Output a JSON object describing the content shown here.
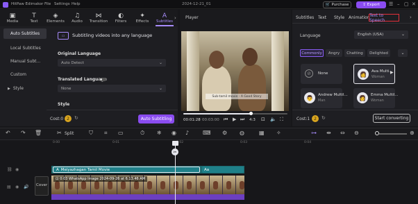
{
  "titlebar": {
    "app_name": "HitPaw Edimakor",
    "menus": [
      "File",
      "Settings",
      "Help"
    ],
    "project_title": "2024-12-21_01",
    "purchase_label": "Purchase",
    "export_label": "Export"
  },
  "toolbar": {
    "tools": [
      {
        "label": "Media",
        "icon": "media-icon"
      },
      {
        "label": "Text",
        "icon": "text-icon"
      },
      {
        "label": "Elements",
        "icon": "elements-icon"
      },
      {
        "label": "Audio",
        "icon": "audio-icon"
      },
      {
        "label": "Transition",
        "icon": "transition-icon"
      },
      {
        "label": "Filters",
        "icon": "filters-icon"
      },
      {
        "label": "Effects",
        "icon": "effects-icon"
      },
      {
        "label": "Subtitles",
        "icon": "subtitles-icon"
      }
    ],
    "active": "Subtitles"
  },
  "sidenav": {
    "items": [
      "Auto Subtitles",
      "Local Subtitles",
      "Manual Subt...",
      "Custom",
      "Style"
    ],
    "active": "Auto Subtitles"
  },
  "subtitles_panel": {
    "header": "Subtitling videos into any language",
    "original_language_label": "Original Language",
    "original_language_value": "Auto Detect",
    "translated_language_label": "Translated Language",
    "translated_language_value": "None",
    "style_label": "Style",
    "cost_label": "Cost:0",
    "coin_count": "2",
    "button_label": "Auto Subtitling"
  },
  "player": {
    "label": "Player",
    "subtitle_overlay": "Sub-tamil movie - A Good Story",
    "time_current": "00:01:28",
    "time_separator": "/",
    "time_total": "00:03:00",
    "zoom": "4:3",
    "progress": 0.65
  },
  "right_panel": {
    "tabs": [
      "Subtitles",
      "Text",
      "Style",
      "Animation",
      "Text to Speech"
    ],
    "active_tab": "Text to Speech",
    "language_label": "Language",
    "language_value": "English (USA)",
    "moods": [
      "Commonly",
      "Angry",
      "Chatting",
      "Delighted"
    ],
    "active_mood": "Commonly",
    "voices": [
      {
        "name": "None",
        "gender": ""
      },
      {
        "name": "Ava Multi...",
        "gender": "Woman"
      },
      {
        "name": "Andrew Multil...",
        "gender": "Man"
      },
      {
        "name": "Emma Multil...",
        "gender": "Woman"
      }
    ],
    "active_voice": "Ava Multi...",
    "cost_label": "Cost:1",
    "coin_count": "2",
    "start_button": "Start converting"
  },
  "timeline_toolbar": {
    "split_label": "Split"
  },
  "timeline": {
    "ticks": [
      "0:00",
      "0:01",
      "0:02",
      "0:03",
      "0:04"
    ],
    "text_clip": "Meiyazhagan Tamil Movie",
    "text_clip_2": "Aa",
    "video_clip": "0:03 WhatsApp Image 2024-09-26 at 6.13.46 AM",
    "cover_label": "Cover"
  },
  "colors": {
    "accent": "#8a4cf0",
    "text_track": "#1f8089",
    "highlight_border": "#e5303a"
  }
}
